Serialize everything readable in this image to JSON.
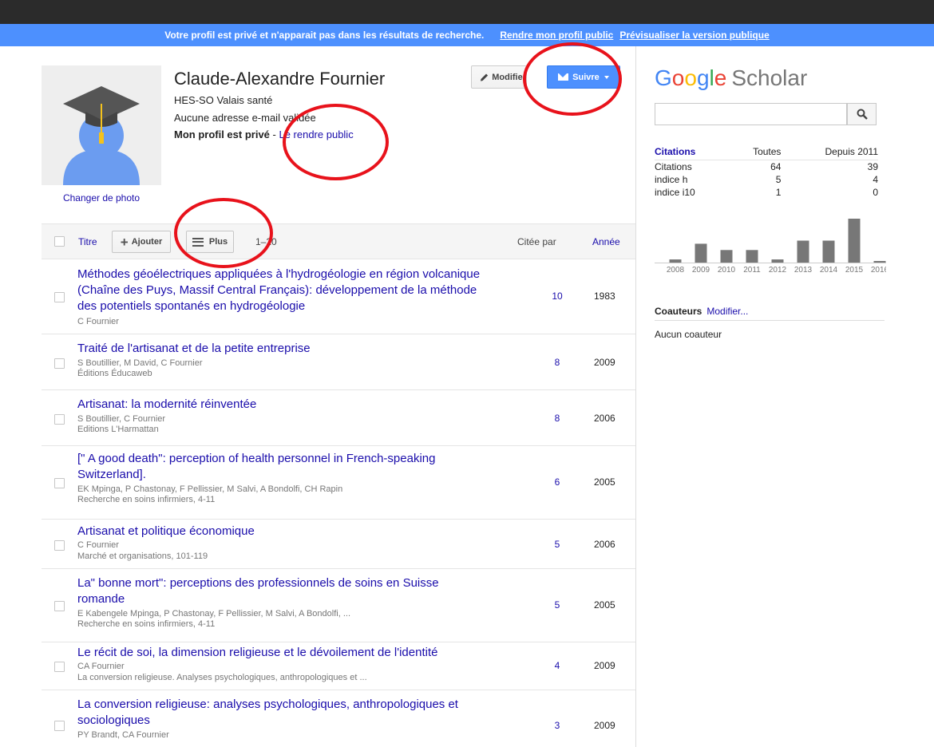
{
  "banner": {
    "message": "Votre profil est privé et n'apparait pas dans les résultats de recherche.",
    "make_public_link": "Rendre mon profil public",
    "preview_link": "Prévisualiser la version publique"
  },
  "profile": {
    "name": "Claude-Alexandre Fournier",
    "affiliation": "HES-SO Valais santé",
    "email_status": "Aucune adresse e-mail validée",
    "private_label": "Mon profil est privé",
    "private_separator": " - ",
    "make_public_link": "Le rendre public",
    "change_photo": "Changer de photo",
    "edit_button": "Modifier",
    "follow_button": "Suivre"
  },
  "toolbar": {
    "title_col": "Titre",
    "add_button": "Ajouter",
    "more_button": "Plus",
    "range": "1–20",
    "cited_by_col": "Citée par",
    "year_col": "Année"
  },
  "articles": [
    {
      "title": "Méthodes géoélectriques appliquées à l'hydrogéologie en région volcanique (Chaîne des Puys, Massif Central Français): développement de la méthode des potentiels spontanés en hydrogéologie",
      "authors": "C Fournier",
      "venue": "",
      "cited": "10",
      "year": "1983"
    },
    {
      "title": "Traité de l'artisanat et de la petite entreprise",
      "authors": "S Boutillier, M David, C Fournier",
      "venue": "Éditions Éducaweb",
      "cited": "8",
      "year": "2009"
    },
    {
      "title": "Artisanat: la modernité réinventée",
      "authors": "S Boutillier, C Fournier",
      "venue": "Editions L'Harmattan",
      "cited": "8",
      "year": "2006"
    },
    {
      "title": "[\" A good death\": perception of health personnel in French-speaking Switzerland].",
      "authors": "EK Mpinga, P Chastonay, F Pellissier, M Salvi, A Bondolfi, CH Rapin",
      "venue": "Recherche en soins infirmiers, 4-11",
      "cited": "6",
      "year": "2005"
    },
    {
      "title": "Artisanat et politique économique",
      "authors": "C Fournier",
      "venue": "Marché et organisations, 101-119",
      "cited": "5",
      "year": "2006"
    },
    {
      "title": "La\" bonne mort\": perceptions des professionnels de soins en Suisse romande",
      "authors": "E Kabengele Mpinga, P Chastonay, F Pellissier, M Salvi, A Bondolfi, ...",
      "venue": "Recherche en soins infirmiers, 4-11",
      "cited": "5",
      "year": "2005"
    },
    {
      "title": "Le récit de soi, la dimension religieuse et le dévoilement de l'identité",
      "authors": "CA Fournier",
      "venue": "La conversion religieuse. Analyses psychologiques, anthropologiques et ...",
      "cited": "4",
      "year": "2009"
    },
    {
      "title": "La conversion religieuse: analyses psychologiques, anthropologiques et sociologiques",
      "authors": "PY Brandt, CA Fournier",
      "venue": "",
      "cited": "3",
      "year": "2009"
    }
  ],
  "sidebar": {
    "logo_google": [
      "G",
      "o",
      "o",
      "g",
      "l",
      "e"
    ],
    "logo_scholar": "Scholar",
    "stats_header": {
      "label": "Citations",
      "all": "Toutes",
      "since": "Depuis 2011"
    },
    "stats": [
      {
        "label": "Citations",
        "all": "64",
        "since": "39"
      },
      {
        "label": "indice h",
        "all": "5",
        "since": "4"
      },
      {
        "label": "indice i10",
        "all": "1",
        "since": "0"
      }
    ],
    "coauthors_title": "Coauteurs",
    "coauthors_edit": "Modifier...",
    "no_coauthors": "Aucun coauteur"
  },
  "chart_data": {
    "type": "bar",
    "categories": [
      "2008",
      "2009",
      "2010",
      "2011",
      "2012",
      "2013",
      "2014",
      "2015",
      "2016"
    ],
    "values": [
      1,
      6,
      4,
      4,
      1,
      7,
      7,
      14,
      0.5
    ],
    "color": "#777777"
  },
  "colors": {
    "accent": "#4d90fe",
    "link": "#1a0dab",
    "annotation": "#e8121b"
  }
}
